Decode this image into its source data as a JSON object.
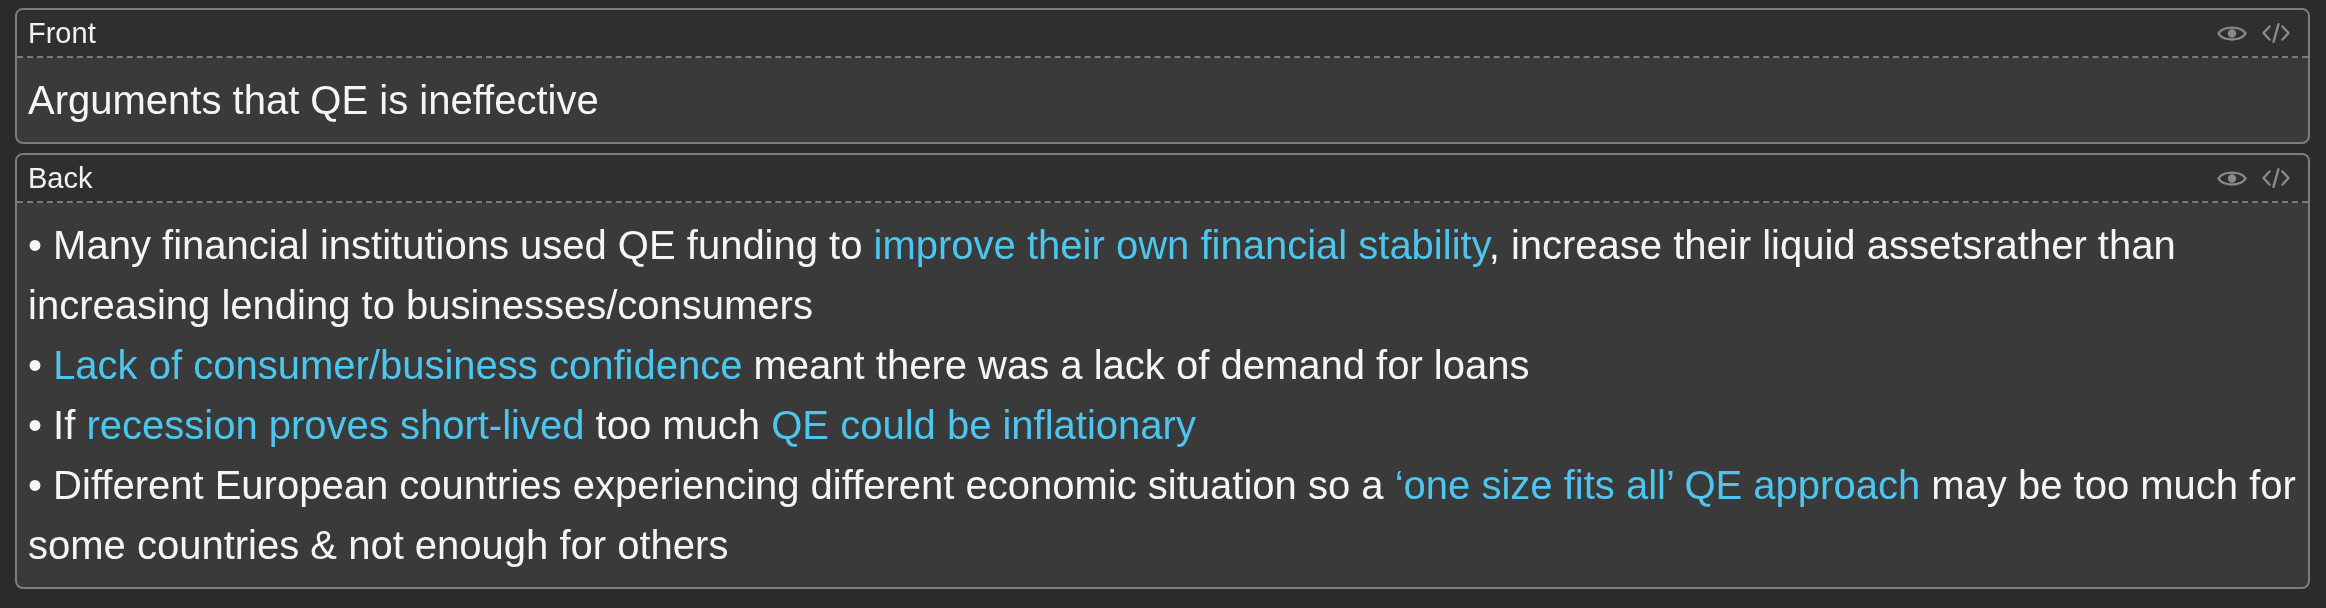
{
  "fields": [
    {
      "label": "Front",
      "paragraphs": [
        {
          "segments": [
            {
              "text": "Arguments that QE is ineffective",
              "highlighted": false
            }
          ]
        }
      ]
    },
    {
      "label": "Back",
      "paragraphs": [
        {
          "segments": [
            {
              "text": "• Many financial institutions used QE funding to ",
              "highlighted": false
            },
            {
              "text": "improve their own financial stability",
              "highlighted": true
            },
            {
              "text": ", increase their liquid assetsrather than increasing lending to businesses/consumers",
              "highlighted": false
            }
          ]
        },
        {
          "segments": [
            {
              "text": "• ",
              "highlighted": false
            },
            {
              "text": "Lack of consumer/business confidence",
              "highlighted": true
            },
            {
              "text": " meant there was a lack of demand for loans",
              "highlighted": false
            }
          ]
        },
        {
          "segments": [
            {
              "text": "• If ",
              "highlighted": false
            },
            {
              "text": "recession proves short-lived",
              "highlighted": true
            },
            {
              "text": " too much ",
              "highlighted": false
            },
            {
              "text": "QE could be inflationary",
              "highlighted": true
            }
          ]
        },
        {
          "segments": [
            {
              "text": "• Different European countries experiencing different economic situation so a ",
              "highlighted": false
            },
            {
              "text": "‘one size fits all’ QE approach",
              "highlighted": true
            },
            {
              "text": " may be too much for some countries & not enough for others",
              "highlighted": false
            }
          ]
        }
      ]
    }
  ]
}
